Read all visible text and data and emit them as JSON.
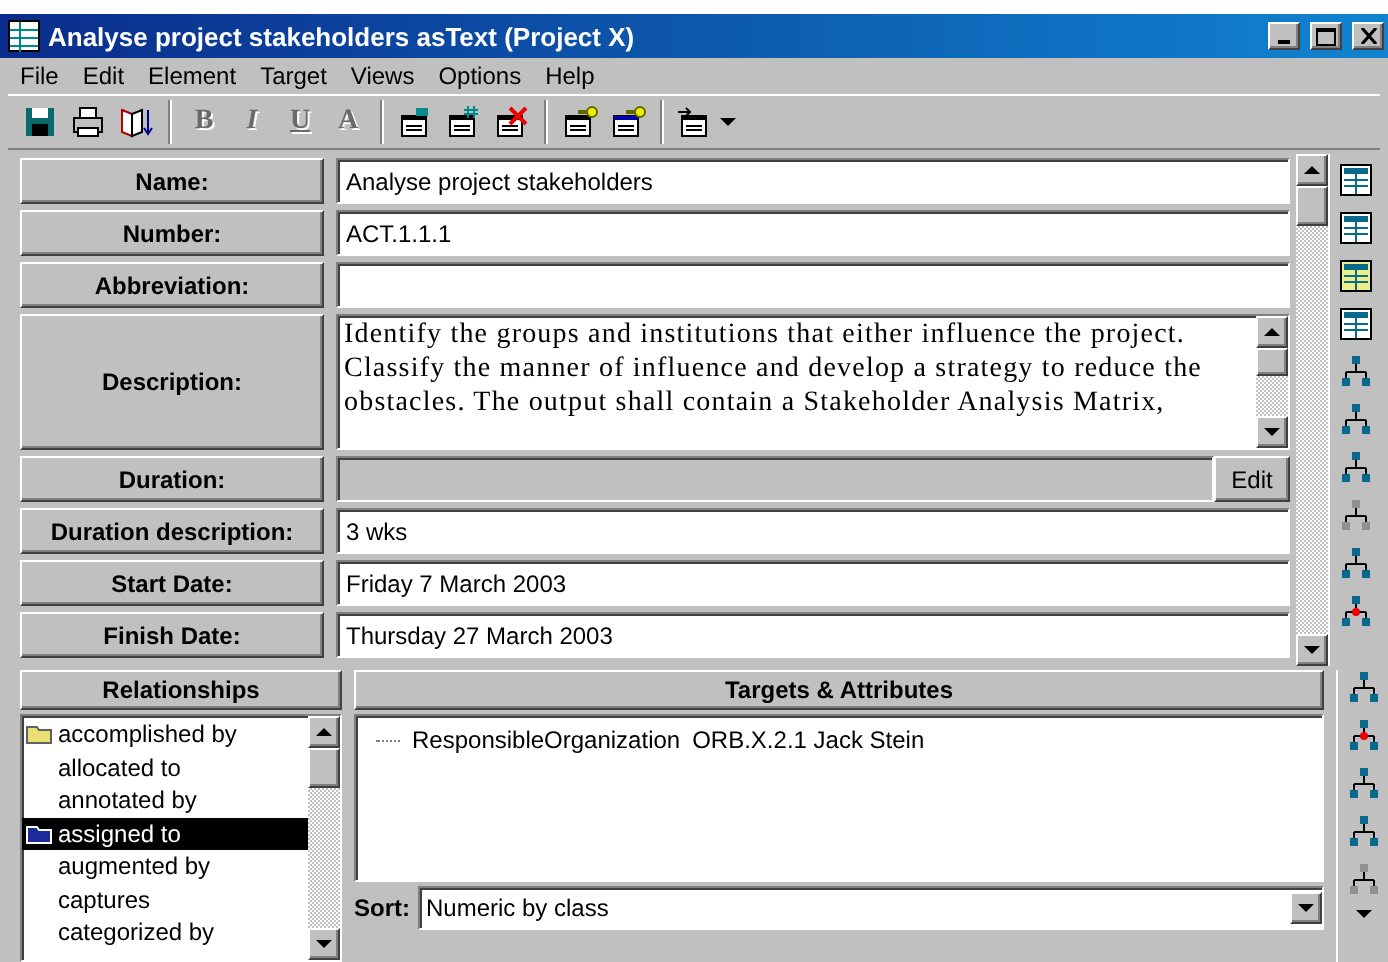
{
  "window": {
    "title": "Analyse project stakeholders asText (Project X)"
  },
  "menu": [
    "File",
    "Edit",
    "Element",
    "Target",
    "Views",
    "Options",
    "Help"
  ],
  "toolbar": [
    {
      "kind": "save",
      "disabled": false
    },
    {
      "kind": "print",
      "disabled": false
    },
    {
      "kind": "book",
      "disabled": false
    },
    {
      "kind": "sep"
    },
    {
      "kind": "letter",
      "text": "B",
      "disabled": true
    },
    {
      "kind": "letter",
      "text": "I",
      "disabled": true
    },
    {
      "kind": "letter",
      "text": "U",
      "disabled": true
    },
    {
      "kind": "letter",
      "text": "A",
      "disabled": true
    },
    {
      "kind": "sep"
    },
    {
      "kind": "add",
      "disabled": false
    },
    {
      "kind": "number",
      "disabled": false
    },
    {
      "kind": "delete",
      "disabled": false
    },
    {
      "kind": "sep"
    },
    {
      "kind": "key",
      "disabled": false
    },
    {
      "kind": "key2",
      "disabled": false
    },
    {
      "kind": "sep"
    },
    {
      "kind": "move",
      "disabled": false
    }
  ],
  "fields": [
    {
      "kind": "text",
      "label": "Name:",
      "value": "Analyse project stakeholders"
    },
    {
      "kind": "text",
      "label": "Number:",
      "value": "ACT.1.1.1"
    },
    {
      "kind": "text",
      "label": "Abbreviation:"
    },
    {
      "kind": "multiline",
      "label": "Description:",
      "value": "Identify the groups and institutions that either influence the project. Classify the manner of influence and develop a strategy to reduce the obstacles. The output shall contain a Stakeholder Analysis Matrix,"
    },
    {
      "kind": "button",
      "label": "Duration:",
      "button": "Edit"
    },
    {
      "kind": "text",
      "label": "Duration description:",
      "value": "3 wks"
    },
    {
      "kind": "text",
      "label": "Start Date:",
      "value": "Friday 7 March 2003"
    },
    {
      "kind": "text",
      "label": "Finish Date:",
      "value": "Thursday 27 March 2003"
    }
  ],
  "relationships": {
    "title": "Relationships",
    "items": [
      {
        "label": "accomplished by",
        "selected": false,
        "color": "#e8e070"
      },
      {
        "label": "allocated to",
        "selected": false
      },
      {
        "label": "annotated by",
        "selected": false
      },
      {
        "label": "assigned to",
        "selected": true,
        "color": "#1c2a9c"
      },
      {
        "label": "augmented by",
        "selected": false
      },
      {
        "label": "captures",
        "selected": false
      },
      {
        "label": "categorized by",
        "selected": false
      }
    ]
  },
  "targets": {
    "title": "Targets & Attributes",
    "items": [
      {
        "attribute": "ResponsibleOrganization",
        "target": "ORB.X.2.1 Jack Stein"
      }
    ],
    "sort_label": "Sort:",
    "sort_value": "Numeric by class"
  }
}
